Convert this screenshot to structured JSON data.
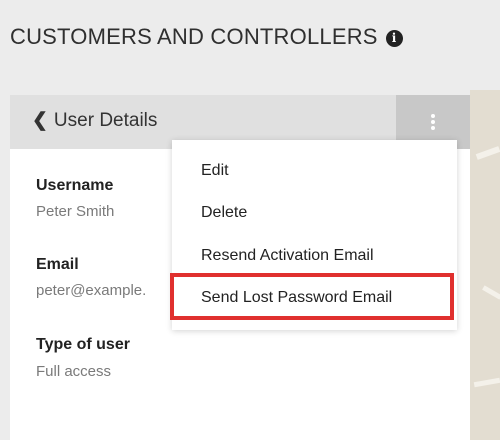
{
  "header": {
    "title": "CUSTOMERS AND CONTROLLERS",
    "info_icon": "info-circle-icon"
  },
  "panel": {
    "back_label": "User Details",
    "back_icon": "chevron-left-icon",
    "menu_icon": "vertical-dots-icon",
    "fields": [
      {
        "label": "Username",
        "value": "Peter Smith"
      },
      {
        "label": "Email",
        "value": "peter@example."
      },
      {
        "label": "Type of user",
        "value": "Full access"
      }
    ]
  },
  "menu": {
    "items": [
      {
        "label": "Edit"
      },
      {
        "label": "Delete"
      },
      {
        "label": "Resend Activation Email"
      },
      {
        "label": "Send Lost Password Email"
      }
    ],
    "highlighted_index": 3
  },
  "colors": {
    "highlight": "#e0302e",
    "panel_header": "#e0e0e0",
    "menu_button": "#c8c8c8"
  }
}
